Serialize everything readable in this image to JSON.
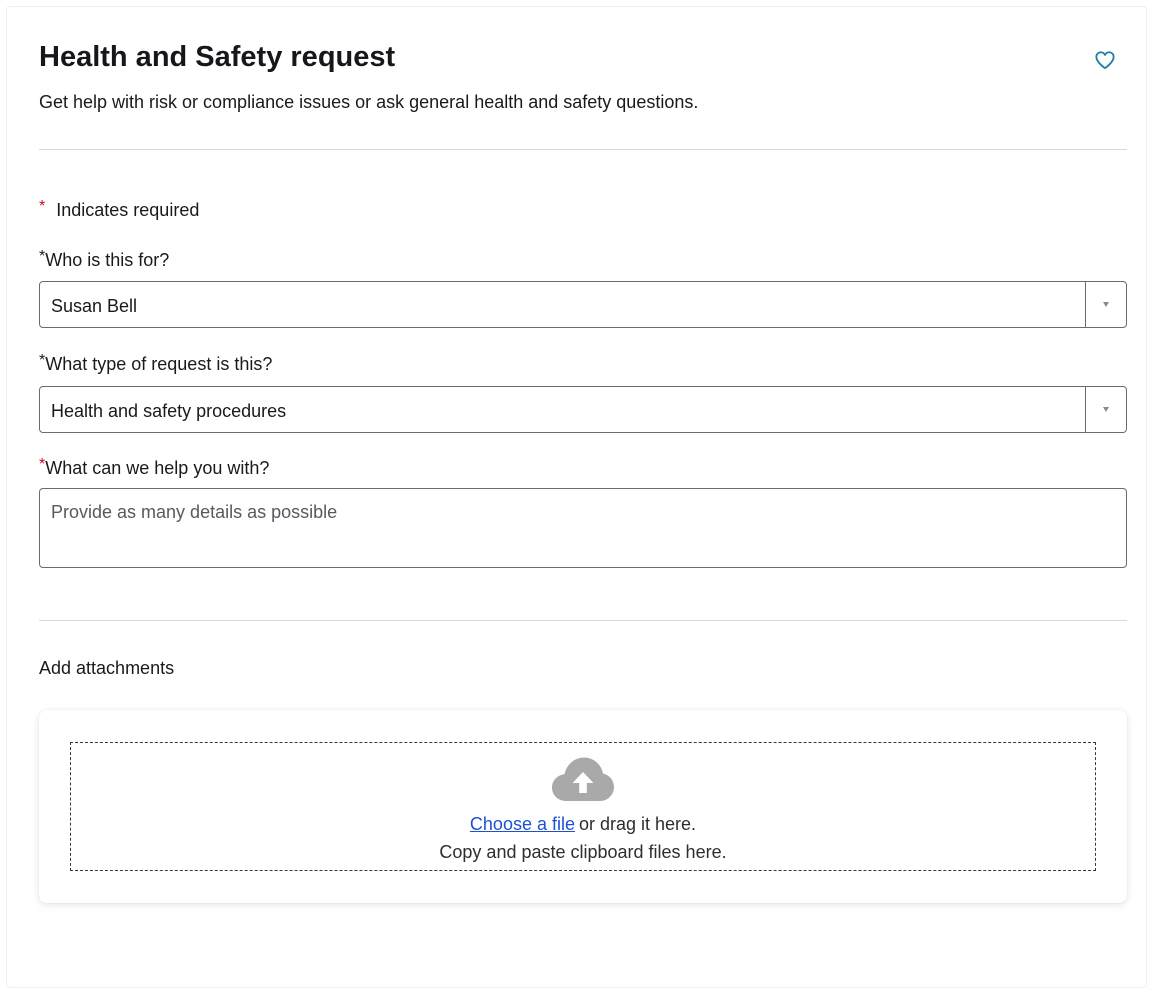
{
  "header": {
    "title": "Health and Safety request",
    "subtitle": "Get help with risk or compliance issues or ask general health and safety questions.",
    "favorite_icon": "heart-outline-icon",
    "accent_color": "#1e7fa3"
  },
  "form": {
    "required_note": "Indicates required",
    "required_marker": "*",
    "who_for": {
      "label": "Who is this for?",
      "value": "Susan Bell"
    },
    "request_type": {
      "label": "What type of request is this?",
      "value": "Health and safety procedures"
    },
    "help_with": {
      "label": "What can we help you with?",
      "placeholder": "Provide as many details as possible"
    }
  },
  "attachments": {
    "label": "Add attachments",
    "upload_icon": "cloud-upload-icon",
    "choose_link": "Choose a file",
    "drag_text": "or drag it here.",
    "paste_text": "Copy and paste clipboard files here."
  },
  "colors": {
    "required_star": "#d0021b",
    "link": "#1f4fd6"
  }
}
